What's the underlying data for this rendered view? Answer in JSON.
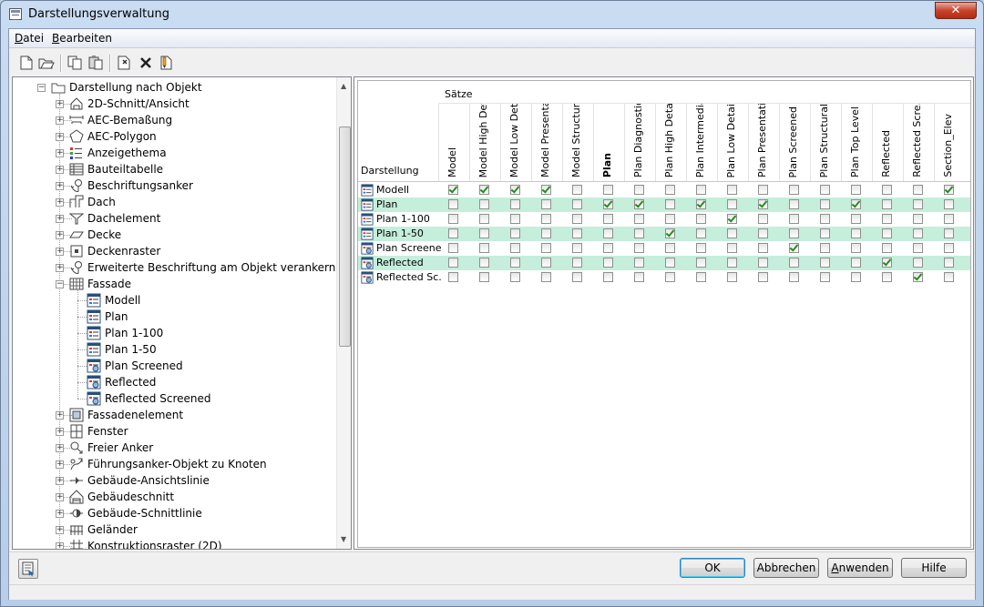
{
  "window": {
    "title": "Darstellungsverwaltung",
    "close": "✕"
  },
  "menu": [
    {
      "label": "Datei",
      "key": "D",
      "rest": "atei"
    },
    {
      "label": "Bearbeiten",
      "key": "B",
      "rest": "earbeiten"
    }
  ],
  "toolbar": [
    "new-icon",
    "open-icon",
    "copy-icon",
    "paste-icon",
    "purge-icon",
    "delete-icon",
    "edit-icon"
  ],
  "tree": {
    "root": "Darstellung nach Objekt",
    "items": [
      {
        "label": "2D-Schnitt/Ansicht",
        "icon": "section-2d-icon",
        "level": 1,
        "expand": "+"
      },
      {
        "label": "AEC-Bemaßung",
        "icon": "dimension-icon",
        "level": 1,
        "expand": "+"
      },
      {
        "label": "AEC-Polygon",
        "icon": "polygon-icon",
        "level": 1,
        "expand": "+"
      },
      {
        "label": "Anzeigethema",
        "icon": "display-theme-icon",
        "level": 1,
        "expand": "+"
      },
      {
        "label": "Bauteiltabelle",
        "icon": "table-icon",
        "level": 1,
        "expand": "+"
      },
      {
        "label": "Beschriftungsanker",
        "icon": "anchor-icon",
        "level": 1,
        "expand": "+"
      },
      {
        "label": "Dach",
        "icon": "roof-icon",
        "level": 1,
        "expand": "+"
      },
      {
        "label": "Dachelement",
        "icon": "roof-slab-icon",
        "level": 1,
        "expand": "+"
      },
      {
        "label": "Decke",
        "icon": "slab-icon",
        "level": 1,
        "expand": "+"
      },
      {
        "label": "Deckenraster",
        "icon": "ceiling-grid-icon",
        "level": 1,
        "expand": "+"
      },
      {
        "label": "Erweiterte Beschriftung am Objekt verankern",
        "icon": "anchor-icon",
        "level": 1,
        "expand": "+"
      },
      {
        "label": "Fassade",
        "icon": "curtain-wall-icon",
        "level": 1,
        "expand": "-"
      },
      {
        "label": "Modell",
        "icon": "display-rep-icon",
        "level": 2
      },
      {
        "label": "Plan",
        "icon": "display-rep-icon",
        "level": 2
      },
      {
        "label": "Plan 1-100",
        "icon": "display-rep-icon",
        "level": 2
      },
      {
        "label": "Plan 1-50",
        "icon": "display-rep-icon",
        "level": 2
      },
      {
        "label": "Plan Screened",
        "icon": "display-rep-screened-icon",
        "level": 2
      },
      {
        "label": "Reflected",
        "icon": "display-rep-screened-icon",
        "level": 2
      },
      {
        "label": "Reflected Screened",
        "icon": "display-rep-screened-icon",
        "level": 2
      },
      {
        "label": "Fassadenelement",
        "icon": "curtain-wall-unit-icon",
        "level": 1,
        "expand": "+"
      },
      {
        "label": "Fenster",
        "icon": "window-icon",
        "level": 1,
        "expand": "+"
      },
      {
        "label": "Freier Anker",
        "icon": "free-anchor-icon",
        "level": 1,
        "expand": "+"
      },
      {
        "label": "Führungsanker-Objekt zu Knoten",
        "icon": "leader-anchor-icon",
        "level": 1,
        "expand": "+"
      },
      {
        "label": "Gebäude-Ansichtslinie",
        "icon": "elevation-line-icon",
        "level": 1,
        "expand": "+"
      },
      {
        "label": "Gebäudeschnitt",
        "icon": "building-section-icon",
        "level": 1,
        "expand": "+"
      },
      {
        "label": "Gebäude-Schnittlinie",
        "icon": "section-line-icon",
        "level": 1,
        "expand": "+"
      },
      {
        "label": "Geländer",
        "icon": "railing-icon",
        "level": 1,
        "expand": "+"
      },
      {
        "label": "Konstruktionsraster (2D)",
        "icon": "grid-2d-icon",
        "level": 1,
        "expand": "+"
      }
    ]
  },
  "grid": {
    "sets_label": "Sätze",
    "rep_label": "Darstellung",
    "columns": [
      "Model",
      "Model High Det...",
      "Model Low Detail",
      "Model Presenta...",
      "Model Structural",
      "Plan",
      "Plan Diagnostic",
      "Plan High Detail",
      "Plan Intermedia...",
      "Plan Low Detail",
      "Plan Presentation",
      "Plan Screened",
      "Plan Structural",
      "Plan Top Level",
      "Reflected",
      "Reflected Scre...",
      "Section_Elev"
    ],
    "bold_column": 5,
    "rows": [
      {
        "name": "Modell",
        "icon": "display-rep-icon",
        "checks": [
          1,
          1,
          1,
          1,
          0,
          0,
          0,
          0,
          0,
          0,
          0,
          0,
          0,
          0,
          0,
          0,
          1
        ]
      },
      {
        "name": "Plan",
        "icon": "display-rep-icon",
        "checks": [
          0,
          0,
          0,
          0,
          0,
          1,
          1,
          0,
          1,
          0,
          1,
          0,
          0,
          1,
          0,
          0,
          0
        ]
      },
      {
        "name": "Plan 1-100",
        "icon": "display-rep-icon",
        "checks": [
          0,
          0,
          0,
          0,
          0,
          0,
          0,
          0,
          0,
          1,
          0,
          0,
          0,
          0,
          0,
          0,
          0
        ]
      },
      {
        "name": "Plan 1-50",
        "icon": "display-rep-icon",
        "checks": [
          0,
          0,
          0,
          0,
          0,
          0,
          0,
          1,
          0,
          0,
          0,
          0,
          0,
          0,
          0,
          0,
          0
        ]
      },
      {
        "name": "Plan Screened",
        "icon": "display-rep-screened-icon",
        "checks": [
          0,
          0,
          0,
          0,
          0,
          0,
          0,
          0,
          0,
          0,
          0,
          1,
          0,
          0,
          0,
          0,
          0
        ]
      },
      {
        "name": "Reflected",
        "icon": "display-rep-screened-icon",
        "checks": [
          0,
          0,
          0,
          0,
          0,
          0,
          0,
          0,
          0,
          0,
          0,
          0,
          0,
          0,
          1,
          0,
          0
        ]
      },
      {
        "name": "Reflected Sc...",
        "icon": "display-rep-screened-icon",
        "checks": [
          0,
          0,
          0,
          0,
          0,
          0,
          0,
          0,
          0,
          0,
          0,
          0,
          0,
          0,
          0,
          1,
          0
        ]
      }
    ]
  },
  "buttons": {
    "ok": "OK",
    "cancel": "Abbrechen",
    "apply_key": "A",
    "apply_rest": "nwenden",
    "help": "Hilfe"
  },
  "colors": {
    "row_highlight": "#c5eedb",
    "check": "#2b8a22"
  }
}
